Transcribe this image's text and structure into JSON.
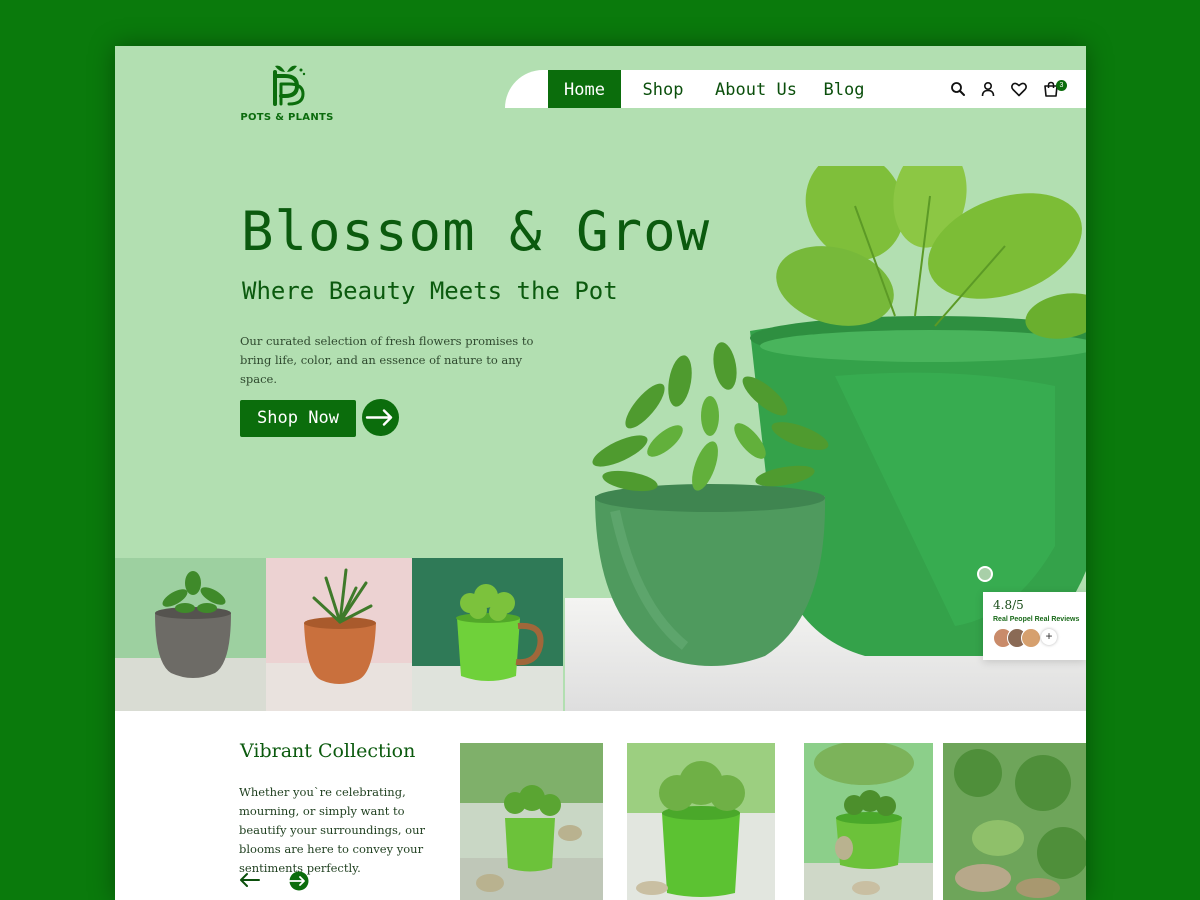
{
  "brand": {
    "name": "POTS & PLANTS"
  },
  "nav": {
    "items": [
      {
        "label": "Home"
      },
      {
        "label": "Shop"
      },
      {
        "label": "About Us"
      },
      {
        "label": "Blog"
      }
    ],
    "icons": [
      "search-icon",
      "user-icon",
      "heart-icon",
      "cart-icon"
    ],
    "cart_count": "3"
  },
  "hero": {
    "title": "Blossom & Grow",
    "subtitle": "Where Beauty Meets the Pot",
    "description": "Our curated selection of fresh flowers promises to bring life, color, and an essence of nature to any space.",
    "cta_label": "Shop Now"
  },
  "reviews": {
    "score": "4.8/5",
    "caption": "Real Peopel Real Reviews"
  },
  "collection": {
    "title": "Vibrant Collection",
    "description": "Whether you`re celebrating, mourning, or simply want to beautify your surroundings, our blooms are here to convey your sentiments perfectly."
  },
  "colors": {
    "page_bg": "#0a7a0c",
    "hero_bg": "#b2dfb1",
    "accent": "#0b6d0c",
    "heading": "#0b5a0e"
  }
}
